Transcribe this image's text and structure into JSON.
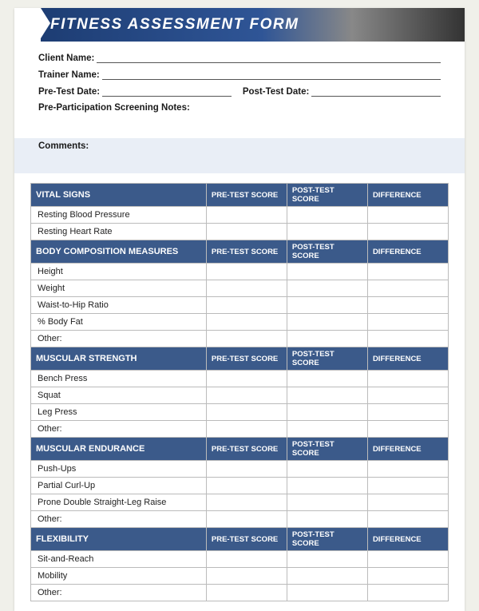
{
  "header": {
    "title": "FITNESS ASSESSMENT FORM"
  },
  "fields": {
    "clientName": "Client Name:",
    "trainerName": "Trainer Name:",
    "preTestDate": "Pre-Test Date:",
    "postTestDate": "Post-Test Date:",
    "screeningNotes": "Pre-Participation Screening Notes:",
    "comments": "Comments:"
  },
  "columns": {
    "preTest": "PRE-TEST SCORE",
    "postTest": "POST-TEST SCORE",
    "difference": "DIFFERENCE"
  },
  "sections": [
    {
      "title": "VITAL SIGNS",
      "rows": [
        "Resting Blood Pressure",
        "Resting Heart Rate"
      ]
    },
    {
      "title": "BODY COMPOSITION MEASURES",
      "rows": [
        "Height",
        "Weight",
        "Waist-to-Hip Ratio",
        "% Body Fat",
        "Other:"
      ]
    },
    {
      "title": "MUSCULAR STRENGTH",
      "rows": [
        "Bench Press",
        "Squat",
        "Leg Press",
        "Other:"
      ]
    },
    {
      "title": "MUSCULAR ENDURANCE",
      "rows": [
        "Push-Ups",
        "Partial Curl-Up",
        "Prone Double Straight-Leg Raise",
        "Other:"
      ]
    },
    {
      "title": "FLEXIBILITY",
      "rows": [
        "Sit-and-Reach",
        "Mobility",
        "Other:"
      ]
    }
  ]
}
